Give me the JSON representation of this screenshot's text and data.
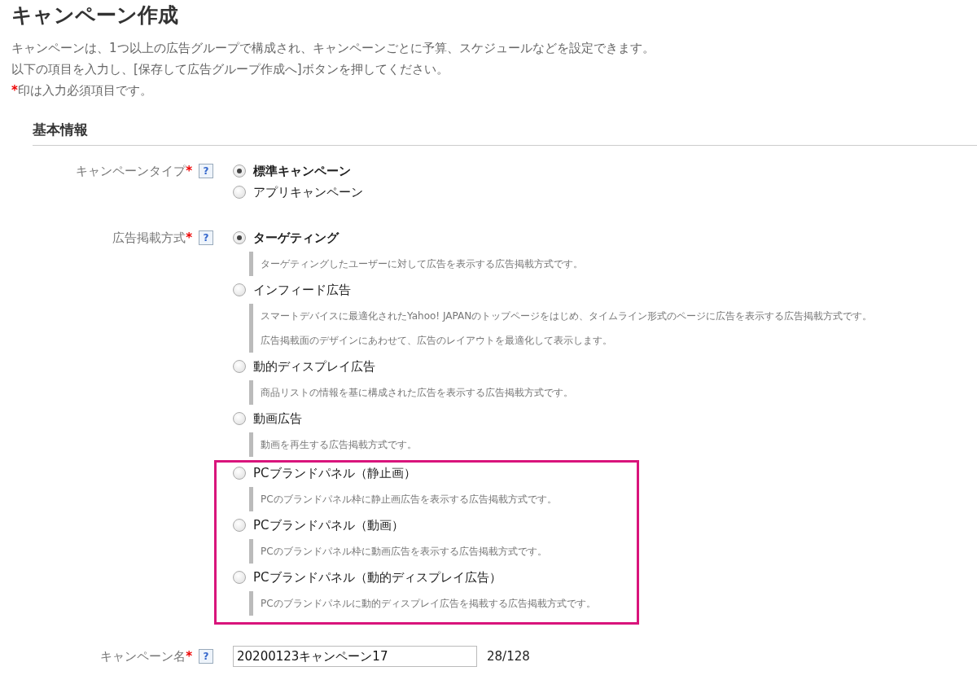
{
  "title": "キャンペーン作成",
  "intro": [
    "キャンペーンは、1つ以上の広告グループで構成され、キャンペーンごとに予算、スケジュールなどを設定できます。",
    "以下の項目を入力し、[保存して広告グループ作成へ]ボタンを押してください。"
  ],
  "required_note": {
    "mark": "*",
    "text": "印は入力必須項目です。"
  },
  "section": {
    "title": "基本情報",
    "fields": [
      {
        "kind": "radio",
        "label": "キャンペーンタイプ",
        "required_mark": "*",
        "help_icon": "?",
        "options": [
          {
            "label": "標準キャンペーン",
            "selected": true,
            "highlighted": false
          },
          {
            "label": "アプリキャンペーン",
            "selected": false,
            "highlighted": false
          }
        ]
      },
      {
        "kind": "radio",
        "label": "広告掲載方式",
        "required_mark": "*",
        "help_icon": "?",
        "options": [
          {
            "label": "ターゲティング",
            "selected": true,
            "highlighted": false,
            "description": [
              "ターゲティングしたユーザーに対して広告を表示する広告掲載方式です。"
            ]
          },
          {
            "label": "インフィード広告",
            "selected": false,
            "highlighted": false,
            "description": [
              "スマートデバイスに最適化されたYahoo! JAPANのトップページをはじめ、タイムライン形式のページに広告を表示する広告掲載方式です。",
              "広告掲載面のデザインにあわせて、広告のレイアウトを最適化して表示します。"
            ]
          },
          {
            "label": "動的ディスプレイ広告",
            "selected": false,
            "highlighted": false,
            "description": [
              "商品リストの情報を基に構成された広告を表示する広告掲載方式です。"
            ]
          },
          {
            "label": "動画広告",
            "selected": false,
            "highlighted": false,
            "description": [
              "動画を再生する広告掲載方式です。"
            ]
          },
          {
            "label": "PCブランドパネル（静止画）",
            "selected": false,
            "highlighted": true,
            "description": [
              "PCのブランドパネル枠に静止画広告を表示する広告掲載方式です。"
            ]
          },
          {
            "label": "PCブランドパネル（動画）",
            "selected": false,
            "highlighted": true,
            "description": [
              "PCのブランドパネル枠に動画広告を表示する広告掲載方式です。"
            ]
          },
          {
            "label": "PCブランドパネル（動的ディスプレイ広告）",
            "selected": false,
            "highlighted": true,
            "description": [
              "PCのブランドパネルに動的ディスプレイ広告を掲載する広告掲載方式です。"
            ]
          }
        ]
      },
      {
        "kind": "text",
        "label": "キャンペーン名",
        "required_mark": "*",
        "help_icon": "?",
        "value": "20200123キャンペーン17",
        "counter": "28/128"
      }
    ]
  }
}
